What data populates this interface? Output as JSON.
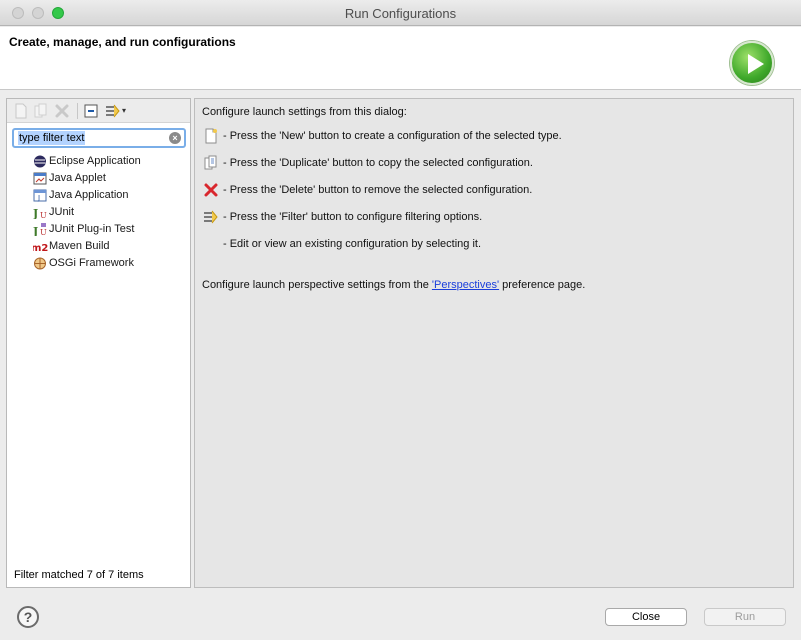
{
  "window": {
    "title": "Run Configurations"
  },
  "banner": {
    "title": "Create, manage, and run configurations",
    "icon": "run-icon"
  },
  "toolbar": {
    "icons": [
      "new-config-icon",
      "duplicate-icon",
      "delete-icon",
      "collapse-all-icon",
      "filter-icon",
      "dropdown-arrow-icon"
    ],
    "dropdown_glyph": "▾"
  },
  "filter": {
    "value": "type filter text",
    "clear_glyph": "×"
  },
  "tree": {
    "items": [
      {
        "label": "Eclipse Application",
        "icon": "eclipse-icon"
      },
      {
        "label": "Java Applet",
        "icon": "applet-icon"
      },
      {
        "label": "Java Application",
        "icon": "java-app-icon"
      },
      {
        "label": "JUnit",
        "icon": "junit-icon"
      },
      {
        "label": "JUnit Plug-in Test",
        "icon": "junit-plugin-icon"
      },
      {
        "label": "Maven Build",
        "icon": "maven-icon"
      },
      {
        "label": "OSGi Framework",
        "icon": "osgi-icon"
      }
    ]
  },
  "status": {
    "filter_matched": "Filter matched 7 of 7 items"
  },
  "help": {
    "intro": "Configure launch settings from this dialog:",
    "lines": [
      {
        "text": "- Press the 'New' button to create a configuration of the selected type.",
        "icon": "new-config-icon"
      },
      {
        "text": "- Press the 'Duplicate' button to copy the selected configuration.",
        "icon": "duplicate-icon"
      },
      {
        "text": "- Press the 'Delete' button to remove the selected configuration.",
        "icon": "delete-icon"
      },
      {
        "text": "- Press the 'Filter' button to configure filtering options.",
        "icon": "filter-icon"
      },
      {
        "text": "- Edit or view an existing configuration by selecting it."
      }
    ],
    "perspective_prefix": "Configure launch perspective settings from the ",
    "perspective_link": "'Perspectives'",
    "perspective_suffix": " preference page."
  },
  "buttons": {
    "help_glyph": "?",
    "close": "Close",
    "run": "Run"
  },
  "colors": {
    "accent": "#7aaee8",
    "link": "#1a3edb",
    "run_green": "#3ea82a",
    "delete_red": "#d9272e"
  }
}
